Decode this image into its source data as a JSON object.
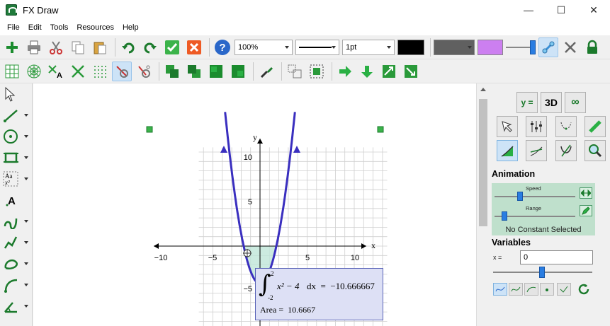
{
  "window": {
    "title": "FX Draw",
    "controls": [
      "—",
      "☐",
      "✕"
    ]
  },
  "menu": [
    "File",
    "Edit",
    "Tools",
    "Resources",
    "Help"
  ],
  "toolbar": {
    "zoom": "100%",
    "line_width": "1pt",
    "colors": {
      "line": "#000000",
      "fill": "#606060",
      "highlight": "#cc7ff0"
    }
  },
  "graph": {
    "x_ticks": [
      "−10",
      "−5",
      "5",
      "10"
    ],
    "y_ticks": [
      "10",
      "5",
      "−5"
    ],
    "x_label": "x",
    "y_label": "y",
    "curve_color": "#3a2fbf",
    "shade_color": "#bfe6d8"
  },
  "integral": {
    "upper": "2",
    "lower": "-2",
    "expression": "x² − 4",
    "result": "dx  =  −10.666667",
    "area": "Area =  10.6667"
  },
  "side": {
    "top_buttons": [
      "y =",
      "3D",
      "∞"
    ],
    "animation_title": "Animation",
    "speed_label": "Speed",
    "range_label": "Range",
    "animation_status": "No Constant Selected",
    "variables_title": "Variables",
    "var_name": "x =",
    "var_value": "0"
  }
}
